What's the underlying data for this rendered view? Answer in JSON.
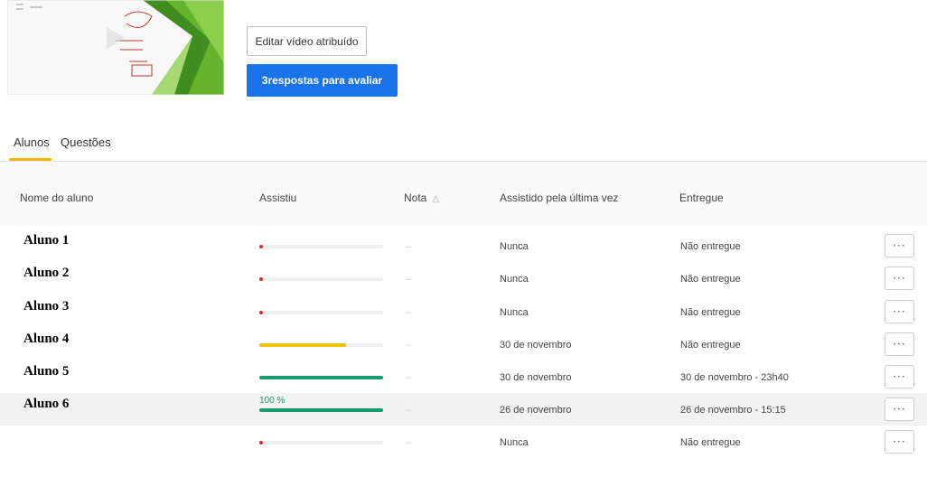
{
  "actions": {
    "edit_label": "Editar vídeo atribuído",
    "answers_label": "3respostas para avaliar"
  },
  "tabs": [
    {
      "label": "Alunos",
      "active": true
    },
    {
      "label": "Questões",
      "active": false
    }
  ],
  "table": {
    "columns": [
      "Nome do aluno",
      "Assistiu",
      "Nota",
      "Assistido pela última vez",
      "Entregue"
    ],
    "rows": [
      {
        "name": "Aluno 1",
        "watched": 0.0,
        "watched_color": "#d32f2f",
        "grade": "–",
        "last_watched": "Nunca",
        "delivered": "Não entregue"
      },
      {
        "name": "Aluno 2",
        "watched": 0.0,
        "watched_color": "#d32f2f",
        "grade": "–",
        "last_watched": "Nunca",
        "delivered": "Não entregue"
      },
      {
        "name": "Aluno 3",
        "watched": 0.0,
        "watched_color": "#d32f2f",
        "grade": "–",
        "last_watched": "Nunca",
        "delivered": "Não entregue"
      },
      {
        "name": "Aluno 4",
        "watched": 0.7,
        "watched_color": "#f4c20d",
        "grade": "–",
        "last_watched": "30 de novembro",
        "delivered": "Não entregue"
      },
      {
        "name": "Aluno 5",
        "watched": 1.0,
        "watched_color": "#1a9a6c",
        "grade": "–",
        "last_watched": "30 de novembro",
        "delivered": "30 de novembro - 23h40"
      },
      {
        "name": "Aluno 6",
        "watched": 1.0,
        "watched_color": "#1a9a6c",
        "watched_label": "100 %",
        "grade": "–",
        "last_watched": "26 de novembro",
        "delivered": "26 de novembro - 15:15"
      },
      {
        "name": "",
        "watched": 0.0,
        "watched_color": "#d32f2f",
        "grade": "–",
        "last_watched": "Nunca",
        "delivered": "Não entregue"
      }
    ],
    "more_label": "···"
  },
  "colors": {
    "primary": "#1a73e8",
    "tab_accent": "#f4b400",
    "complete": "#1a9a6c",
    "partial": "#f4c20d",
    "none": "#d32f2f"
  }
}
